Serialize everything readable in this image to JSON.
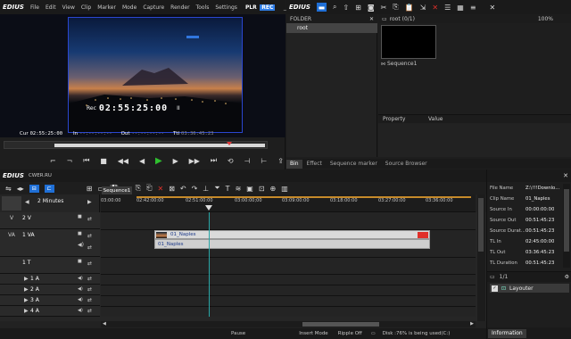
{
  "player": {
    "brand": "EDIUS",
    "menu": [
      "File",
      "Edit",
      "View",
      "Clip",
      "Marker",
      "Mode",
      "Capture",
      "Render",
      "Tools",
      "Settings"
    ],
    "plr": "PLR",
    "rec": "REC",
    "overlay_timecode": "02:55:25:00",
    "overlay_rec": "Rec",
    "pause_glyph": "II",
    "cur_label": "Cur",
    "cur_value": "02:55:25:00",
    "in_label": "In",
    "in_value": "--:--:--:--",
    "out_label": "Out",
    "out_value": "--:--:--:--",
    "ttl_label": "Ttl",
    "ttl_value": "03:36:45:23"
  },
  "bin": {
    "brand": "EDIUS",
    "folder_header": "FOLDER",
    "root_folder": "root",
    "path_title": "root (0/1)",
    "zoom": "100%",
    "clip_name": "Sequence1",
    "property_header": "Property",
    "value_header": "Value",
    "tabs": [
      "Bin",
      "Effect",
      "Sequence marker",
      "Source Browser"
    ],
    "active_tab": "Bin"
  },
  "timeline": {
    "brand": "EDIUS",
    "project": "CWER.RU",
    "sequence_tab": "Sequence1",
    "scale": "2 Minutes",
    "ruler": [
      "03:00:00",
      "02:42:00:00",
      "02:51:00:00",
      "03:00:00;00",
      "03:09:00:00",
      "03:18:00:00",
      "03:27:00:00",
      "03:36:00:00"
    ],
    "tracks": [
      {
        "type": "V",
        "name": "2 V"
      },
      {
        "type": "VA",
        "name": "1 VA"
      },
      {
        "type": "T",
        "name": "1 T"
      },
      {
        "type": "A",
        "name": "1 A"
      },
      {
        "type": "A",
        "name": "2 A"
      },
      {
        "type": "A",
        "name": "3 A"
      },
      {
        "type": "A",
        "name": "4 A"
      }
    ],
    "video_clip": "01_Naples",
    "audio_clip": "01_Naples",
    "status": {
      "pause": "Pause",
      "insert": "Insert Mode",
      "ripple": "Ripple Off",
      "disk": "Disk :76% is being used(C:)"
    }
  },
  "info": {
    "rows": [
      {
        "label": "File Name",
        "value": "Z:\\!!!Downlo..."
      },
      {
        "label": "Clip Name",
        "value": "01_Naples"
      },
      {
        "label": "Source In",
        "value": "00:00:00:00"
      },
      {
        "label": "Source Out",
        "value": "00:51:45:23"
      },
      {
        "label": "Source Durat...",
        "value": "00:51:45:23"
      },
      {
        "label": "TL In",
        "value": "02:45:00:00"
      },
      {
        "label": "TL Out",
        "value": "03:36:45:23"
      },
      {
        "label": "TL Duration",
        "value": "00:51:45:23"
      }
    ],
    "layer_count": "1/1",
    "layer_name": "Layouter",
    "tab": "Information"
  },
  "colors": {
    "accent": "#1f6fd6",
    "rec": "#2f7ee8",
    "play": "#2fc02f",
    "stop_red": "#e0302a",
    "playhead": "#2aa6a6"
  }
}
